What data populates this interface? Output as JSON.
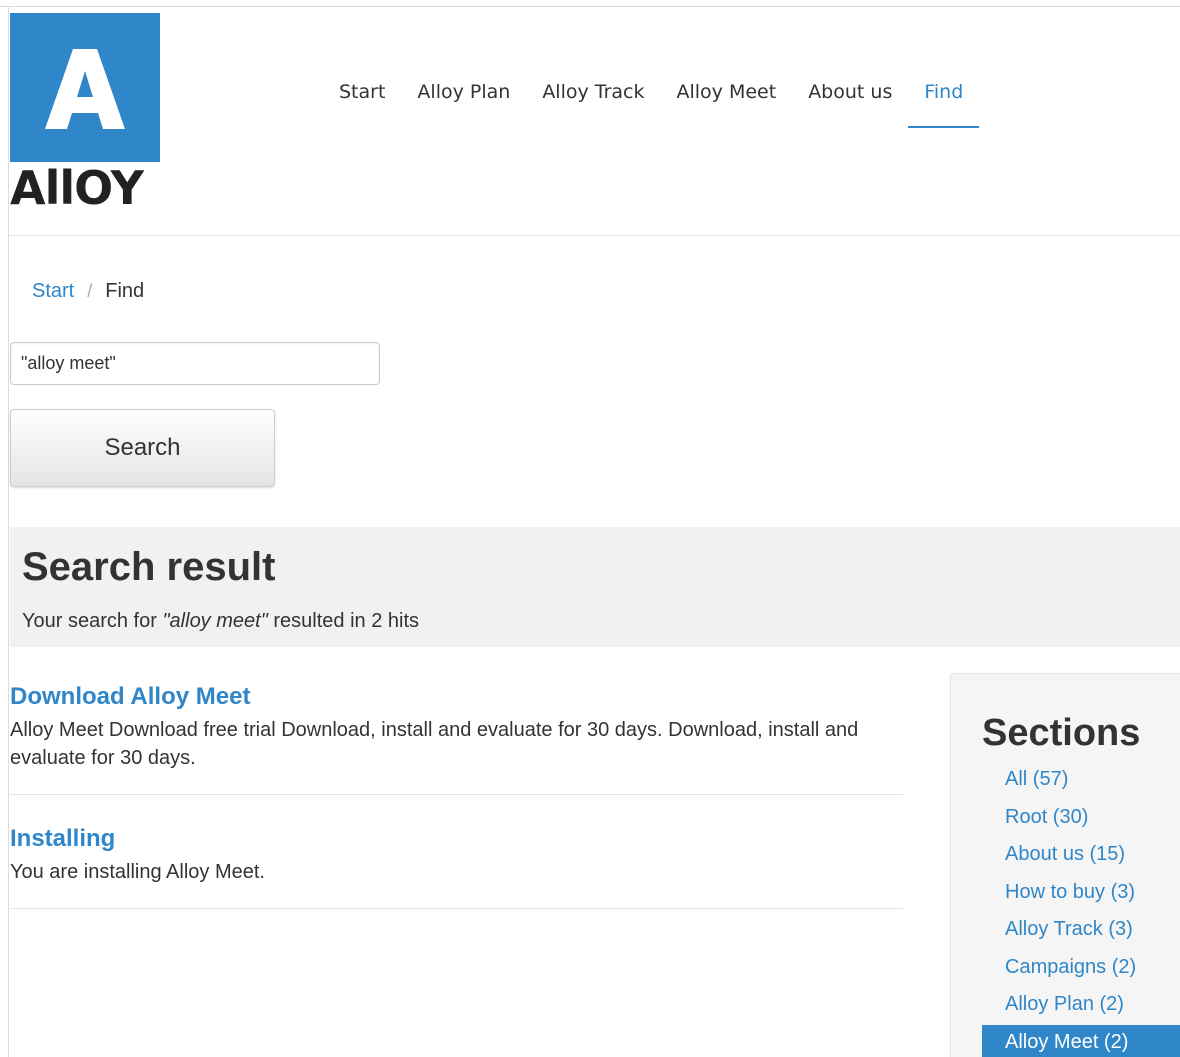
{
  "logo": {
    "letter": "A",
    "word": "AllOY",
    "colors": {
      "box": "#2f86c8",
      "word": "#222222"
    }
  },
  "nav": {
    "items": [
      {
        "label": "Start"
      },
      {
        "label": "Alloy Plan"
      },
      {
        "label": "Alloy Track"
      },
      {
        "label": "Alloy Meet"
      },
      {
        "label": "About us"
      },
      {
        "label": "Find",
        "active": true
      }
    ]
  },
  "breadcrumb": {
    "home": "Start",
    "separator": "/",
    "current": "Find"
  },
  "search": {
    "value": "\"alloy meet\"",
    "button_label": "Search"
  },
  "results": {
    "title": "Search result",
    "summary_prefix": "Your search for ",
    "query": "\"alloy meet\"",
    "summary_suffix": " resulted in 2 hits",
    "hits": [
      {
        "title": "Download Alloy Meet",
        "text": "Alloy Meet Download free trial Download, install and evaluate for 30 days. Download, install and evaluate for 30 days."
      },
      {
        "title": "Installing",
        "text": "You are installing Alloy Meet."
      }
    ]
  },
  "sections": {
    "title": "Sections",
    "items": [
      {
        "label": "All (57)"
      },
      {
        "label": "Root (30)"
      },
      {
        "label": "About us (15)"
      },
      {
        "label": "How to buy (3)"
      },
      {
        "label": "Alloy Track (3)"
      },
      {
        "label": "Campaigns (2)"
      },
      {
        "label": "Alloy Plan (2)"
      },
      {
        "label": "Alloy Meet (2)",
        "active": true
      }
    ]
  },
  "colors": {
    "accent": "#2f86c8",
    "panel": "#f1f1f1"
  }
}
